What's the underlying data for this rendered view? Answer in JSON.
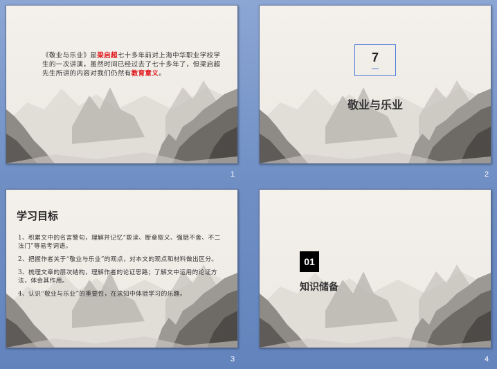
{
  "slides": [
    {
      "number": "1",
      "text_parts": [
        "《敬业与乐业》是",
        "梁启超",
        "七十多年前对上海中华职业学校学生的一次讲演，虽然时间已经过去了七十多年了，但梁启超先生所讲的内容对我们仍然有",
        "教育意义",
        "。"
      ]
    },
    {
      "number": "2",
      "lesson_number": "7",
      "title": "敬业与乐业"
    },
    {
      "number": "3",
      "title": "学习目标",
      "items": [
        "1、积累文中的名言警句，理解并记忆“亵渎、断章取义、强聒不舍、不二法门”等易考词语。",
        "2、把握作者关于“敬业与乐业”的观点，对本文的观点和材料做出区分。",
        "3、梳理文章的层次结构，理解作者的论证思路；了解文中运用的论证方法，体会其作用。",
        "4、认识“敬业与乐业”的重要性，在求知中体验学习的乐趣。"
      ]
    },
    {
      "number": "4",
      "badge": "01",
      "title": "知识储备"
    }
  ],
  "colors": {
    "highlight": "#e0161c",
    "frame": "#4c7ad8",
    "background": "#7a96c8"
  }
}
